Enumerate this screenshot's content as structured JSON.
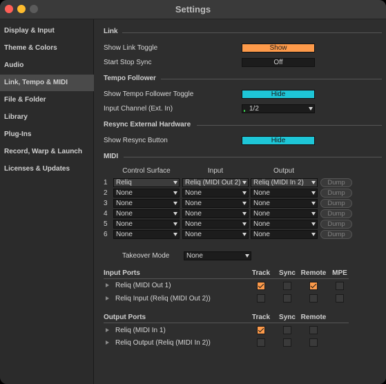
{
  "window": {
    "title": "Settings"
  },
  "sidebar": {
    "items": [
      {
        "label": "Display & Input"
      },
      {
        "label": "Theme & Colors"
      },
      {
        "label": "Audio"
      },
      {
        "label": "Link, Tempo & MIDI",
        "active": true
      },
      {
        "label": "File & Folder"
      },
      {
        "label": "Library"
      },
      {
        "label": "Plug-Ins"
      },
      {
        "label": "Record, Warp & Launch"
      },
      {
        "label": "Licenses & Updates"
      }
    ]
  },
  "link": {
    "section": "Link",
    "show_link_toggle_label": "Show Link Toggle",
    "show_link_toggle_value": "Show",
    "start_stop_sync_label": "Start Stop Sync",
    "start_stop_sync_value": "Off"
  },
  "tempo": {
    "section": "Tempo Follower",
    "show_toggle_label": "Show Tempo Follower Toggle",
    "show_toggle_value": "Hide",
    "input_channel_label": "Input Channel (Ext. In)",
    "input_channel_value": "1/2"
  },
  "resync": {
    "section": "Resync External Hardware",
    "show_button_label": "Show Resync Button",
    "show_button_value": "Hide"
  },
  "midi": {
    "section": "MIDI",
    "columns": {
      "control_surface": "Control Surface",
      "input": "Input",
      "output": "Output"
    },
    "dump_label": "Dump",
    "rows": [
      {
        "num": "1",
        "surface": "Reliq",
        "input": "Reliq (MIDI Out 2)",
        "output": "Reliq (MIDI In 2)"
      },
      {
        "num": "2",
        "surface": "None",
        "input": "None",
        "output": "None"
      },
      {
        "num": "3",
        "surface": "None",
        "input": "None",
        "output": "None"
      },
      {
        "num": "4",
        "surface": "None",
        "input": "None",
        "output": "None"
      },
      {
        "num": "5",
        "surface": "None",
        "input": "None",
        "output": "None"
      },
      {
        "num": "6",
        "surface": "None",
        "input": "None",
        "output": "None"
      }
    ],
    "takeover_label": "Takeover Mode",
    "takeover_value": "None"
  },
  "input_ports": {
    "title": "Input Ports",
    "columns": [
      "Track",
      "Sync",
      "Remote",
      "MPE"
    ],
    "rows": [
      {
        "name": "Reliq (MIDI Out 1)",
        "track": true,
        "sync": false,
        "remote": true,
        "mpe": false
      },
      {
        "name": "Reliq Input (Reliq (MIDI Out 2))",
        "track": false,
        "sync": false,
        "remote": false,
        "mpe": false
      }
    ]
  },
  "output_ports": {
    "title": "Output Ports",
    "columns": [
      "Track",
      "Sync",
      "Remote"
    ],
    "rows": [
      {
        "name": "Reliq (MIDI In 1)",
        "track": true,
        "sync": false,
        "remote": false
      },
      {
        "name": "Reliq Output (Reliq (MIDI In 2))",
        "track": false,
        "sync": false,
        "remote": false
      }
    ]
  },
  "colors": {
    "accent_orange": "#fd9a4a",
    "accent_cyan": "#1ec6d7",
    "background": "#2e2e2e"
  }
}
